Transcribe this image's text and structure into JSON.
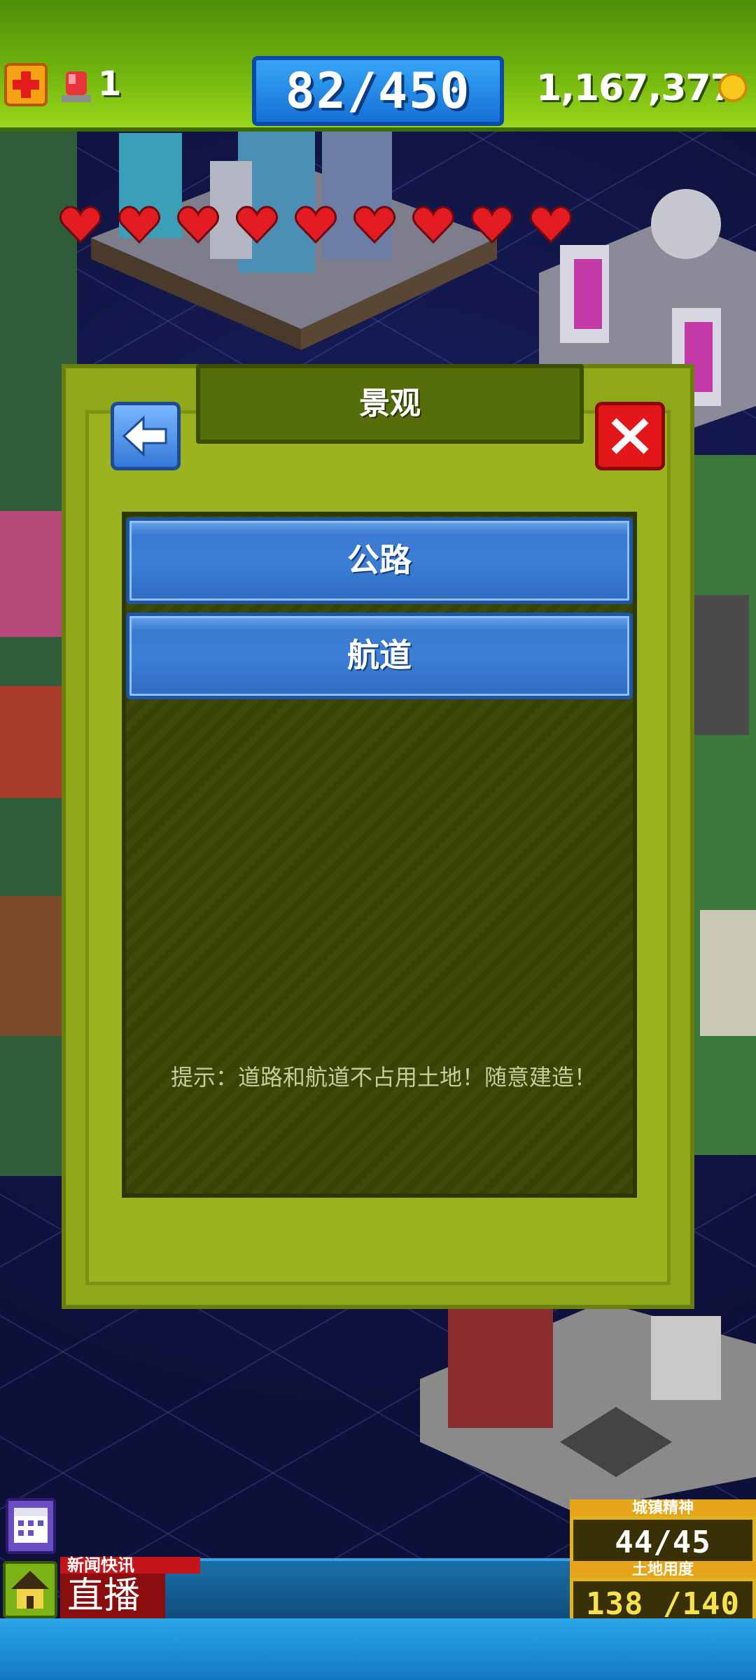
{
  "topbar": {
    "alarm_count": "1",
    "population": "82/450",
    "money": "1,167,377"
  },
  "hearts": {
    "count": 9,
    "color": "#e31b23"
  },
  "modal": {
    "title": "景观",
    "items": [
      {
        "label": "公路"
      },
      {
        "label": "航道"
      }
    ],
    "hint": "提示：道路和航道不占用土地！随意建造！"
  },
  "news": {
    "tag": "新闻快讯",
    "live": "直播"
  },
  "stats": {
    "spirit_title": "城镇精神",
    "spirit_value": "44/45",
    "land_title": "土地用度",
    "land_value": "138 /140"
  },
  "colors": {
    "accent_green": "#8ea81a",
    "button_blue": "#3d7fd6",
    "close_red": "#e3161a"
  }
}
